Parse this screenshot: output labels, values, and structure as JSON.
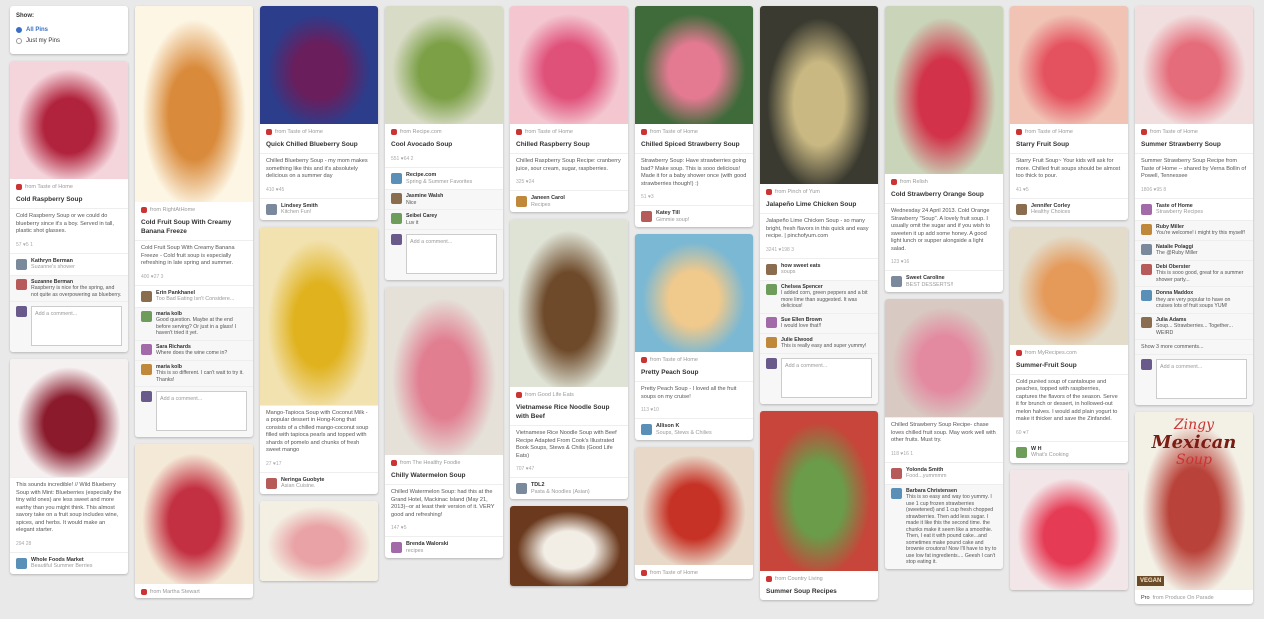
{
  "filter": {
    "title": "Show:",
    "options": [
      "All Pins",
      "Just my Pins"
    ],
    "selected": "All Pins"
  },
  "add_comment_placeholder": "Add a comment...",
  "columns": [
    [
      {
        "img": {
          "h": 118,
          "c1": "#f5d5dc",
          "c2": "#b1233d"
        },
        "src": "from Taste of Home",
        "title": "Cold Raspberry Soup",
        "desc": "Cold Raspberry Soup or we could do blueberry since it's a boy. Served in tall, plastic shot glasses.",
        "stats": "57  ♥5  1",
        "board": {
          "user": "Kathryn Berman",
          "name": "Suzanne's shower"
        },
        "comments": [
          {
            "user": "Suzanne Berman",
            "text": "Raspberry is nice for the spring, and not quite as overpowering as blueberry."
          }
        ],
        "addc": true
      },
      {
        "img": {
          "h": 118,
          "c1": "#f6f1f1",
          "c2": "#8a1a2c"
        },
        "desc": "This sounds incredible! // Wild Blueberry Soup with Mint: Blueberries (especially the tiny wild ones) are less sweet and more earthy than you might think. This almost savory take on a fruit soup includes wine, spices, and herbs. It would make an elegant starter.",
        "stats": "294  28",
        "board": {
          "user": "Whole Foods Market",
          "name": "Beautiful Summer Berries"
        }
      }
    ],
    [
      {
        "img": {
          "h": 196,
          "c1": "#fdf6e4",
          "c2": "#d98a3a"
        },
        "src": "from RightAtHome",
        "title": "Cold Fruit Soup With Creamy Banana Freeze",
        "desc": "Cold Fruit Soup With Creamy Banana Freeze - Cold fruit soup is especially refreshing in late spring and summer.",
        "stats": "400  ♥27  3",
        "board": {
          "user": "Erin Pankhanel",
          "name": "Too Bad Eating Isn't Considere..."
        },
        "comments": [
          {
            "user": "maria kolb",
            "text": "Good question. Maybe at the end before serving? Or just in a glass! I haven't tried it yet."
          },
          {
            "user": "Sara Richards",
            "text": "Where does the wine come in?"
          },
          {
            "user": "maria kolb",
            "text": "This is so different. I can't wait to try it. Thanks!"
          }
        ],
        "addc": true
      },
      {
        "img": {
          "h": 140,
          "c1": "#f4e9d6",
          "c2": "#c33042"
        },
        "src": "from Martha Stewart"
      }
    ],
    [
      {
        "img": {
          "h": 118,
          "c1": "#2c3d8c",
          "c2": "#6a1e5c"
        },
        "src": "from Taste of Home",
        "title": "Quick Chilled Blueberry Soup",
        "desc": "Chilled Blueberry Soup - my mom makes something like this and it's absolutely delicious on a summer day",
        "stats": "410  ♥45",
        "board": {
          "user": "Lindsey Smith",
          "name": "Kitchen Fun!"
        }
      },
      {
        "img": {
          "h": 178,
          "c1": "#f2e2b0",
          "c2": "#e0b21e"
        },
        "desc": "Mango-Tapioca Soup with Coconut Milk - a popular dessert in Hong-Kong that consists of a chilled mango-coconut soup filled with tapioca pearls and topped with shards of pomelo and chunks of fresh sweet mango",
        "stats": "27  ♥17",
        "board": {
          "user": "Neringa Guobyte",
          "name": "Asian Cuisine."
        }
      },
      {
        "img": {
          "h": 80,
          "c1": "#f3efe2",
          "c2": "#e9a3a6"
        }
      }
    ],
    [
      {
        "img": {
          "h": 118,
          "c1": "#d8dbc6",
          "c2": "#7ca046"
        },
        "src": "from Recipe.com",
        "title": "Cool Avocado Soup",
        "desc": "",
        "stats": "551  ♥64  2",
        "board": {
          "user": "Recipe.com",
          "name": "Spring & Summer Favorites"
        },
        "comments": [
          {
            "user": "Jasmine Walsh",
            "text": "Nice"
          },
          {
            "user": "Seibei Carey",
            "text": "Luv it"
          }
        ],
        "addc": true
      },
      {
        "img": {
          "h": 168,
          "c1": "#e5e0d8",
          "c2": "#e17f91"
        },
        "src": "from The Healthy Foodie",
        "title": "Chilly Watermelon Soup",
        "desc": "Chilled Watermelon Soup: had this at the Grand Hotel, Mackinac Island (May 21, 2013)--or at least their version of it. VERY good and refreshing!",
        "stats": "147  ♥5",
        "board": {
          "user": "Brenda Walorski",
          "name": "recipes"
        }
      }
    ],
    [
      {
        "img": {
          "h": 118,
          "c1": "#f3c6d0",
          "c2": "#e0517a"
        },
        "src": "from Taste of Home",
        "title": "Chilled Raspberry Soup",
        "desc": "Chilled Raspberry Soup Recipe: cranberry juice, sour cream, sugar, raspberries.",
        "stats": "325  ♥24",
        "board": {
          "user": "Janeen Carol",
          "name": "Recipes"
        }
      },
      {
        "img": {
          "h": 168,
          "c1": "#dfe3d6",
          "c2": "#6e4a2a"
        },
        "src": "from Good Life Eats",
        "title": "Vietnamese Rice Noodle Soup with Beef",
        "desc": "Vietnamese Rice Noodle Soup with Beef Recipe Adapted From Cook's Illustrated Book Soups, Stews & Chilis (Good Life Eats)",
        "stats": "707  ♥47",
        "board": {
          "user": "TDL2",
          "name": "Pasta & Noodles (Asian)"
        }
      },
      {
        "img": {
          "h": 80,
          "c1": "#6b3a1e",
          "c2": "#f2eee6"
        }
      }
    ],
    [
      {
        "img": {
          "h": 118,
          "c1": "#3f6b3a",
          "c2": "#e47a92"
        },
        "src": "from Taste of Home",
        "title": "Chilled Spiced Strawberry Soup",
        "desc": "Strawberry Soup: Have strawberries going bad? Make soup. This is sooo delicious! Made it for a baby shower once (with good strawberries though!) :)",
        "stats": "51  ♥3",
        "board": {
          "user": "Katey Till",
          "name": "Gimmie soup!"
        }
      },
      {
        "img": {
          "h": 118,
          "c1": "#7ab8d4",
          "c2": "#f0c98c"
        },
        "src": "from Taste of Home",
        "title": "Pretty Peach Soup",
        "desc": "Pretty Peach Soup - I loved all the fruit soups on my cruise!",
        "stats": "113  ♥10",
        "board": {
          "user": "Allison K",
          "name": "Soups, Stews & Chilies"
        }
      },
      {
        "img": {
          "h": 118,
          "c1": "#e8d8c8",
          "c2": "#c63326"
        },
        "src": "from Taste of Home"
      }
    ],
    [
      {
        "img": {
          "h": 178,
          "c1": "#3a3a30",
          "c2": "#c9b882"
        },
        "src": "from Pinch of Yum",
        "title": "Jalapeño Lime Chicken Soup",
        "desc": "Jalapeño Lime Chicken Soup - so many bright, fresh flavors in this quick and easy recipe. | pinchofyum.com",
        "stats": "3241  ♥198  3",
        "board": {
          "user": "how sweet eats",
          "name": "soups"
        },
        "comments": [
          {
            "user": "Chelsea Spencer",
            "text": "I added corn, green peppers and a bit more lime than suggested. It was delicious!"
          },
          {
            "user": "Sue Ellen Brown",
            "text": "I would love that!!"
          },
          {
            "user": "Julie Elwood",
            "text": "This is really easy and super yummy!"
          }
        ],
        "addc": true
      },
      {
        "img": {
          "h": 160,
          "c1": "#c7453a",
          "c2": "#6a9c4a"
        },
        "src": "from Country Living",
        "title": "Summer Soup Recipes"
      }
    ],
    [
      {
        "img": {
          "h": 168,
          "c1": "#c9d4b8",
          "c2": "#d2334a"
        },
        "src": "from Relish",
        "title": "Cold Strawberry Orange Soup",
        "desc": "Wednesday 24 April 2013. Cold Orange Strawberry \"Soup\". A lovely fruit soup. I usually omit the sugar and if you wish to sweeten it up add some honey. A good light lunch or supper alongside a light salad.",
        "stats": "123  ♥16",
        "board": {
          "user": "Sweet Caroline",
          "name": "BEST DESSERTS!!"
        }
      },
      {
        "img": {
          "h": 118,
          "c1": "#d8c9c2",
          "c2": "#e38aa0"
        },
        "desc": "Chilled Strawberry Soup Recipe- chase loves chilled fruit soup. May work well with other fruits. Must try.",
        "stats": "118  ♥16  1",
        "board": {
          "user": "Yolonda Smith",
          "name": "Food...yummmm"
        },
        "comments": [
          {
            "user": "Barbara Christensen",
            "text": "This is so easy and way too yummy. I use 1 cup frozen strawberries (sweetened) and 1 cup fresh chopped strawberries. Then add less sugar. I made it like this the second time. the chunks make it seem like a smoothie. Then, I eat it with pound cake...and sometimes make pound cake and brownie croutons! Now I'll have to try to use low fat ingredients.... Geesh I can't stop eating it."
          }
        ]
      }
    ],
    [
      {
        "img": {
          "h": 118,
          "c1": "#f0c3b5",
          "c2": "#e5525f"
        },
        "src": "from Taste of Home",
        "title": "Starry Fruit Soup",
        "desc": "Starry Fruit Soup~ Your kids will ask for more. Chilled fruit soups should be almost too thick to pour.",
        "stats": "41  ♥5",
        "board": {
          "user": "Jennifer Corley",
          "name": "Healthy Choices"
        }
      },
      {
        "img": {
          "h": 118,
          "c1": "#e3dccb",
          "c2": "#e59a5a"
        },
        "src": "from MyRecipes.com",
        "title": "Summer-Fruit Soup",
        "desc": "Cold puréed soup of cantaloupe and peaches, topped with raspberries, captures the flavors of the season. Serve it for brunch or dessert, in hollowed-out melon halves. I would add plain yogurt to make it thicker and save the Zinfandel.",
        "stats": "60  ♥7",
        "board": {
          "user": "W H",
          "name": "What's Cooking"
        }
      },
      {
        "img": {
          "h": 120,
          "c1": "#f3e6e8",
          "c2": "#e63b55"
        }
      }
    ],
    [
      {
        "img": {
          "h": 118,
          "c1": "#f1dede",
          "c2": "#e56c7a"
        },
        "src": "from Taste of Home",
        "title": "Summer Strawberry Soup",
        "desc": "Summer Strawberry Soup Recipe from Taste of Home -- shared by Verna Bollin of Powell, Tennessee",
        "stats": "1806  ♥95  8",
        "board": {
          "user": "Taste of Home",
          "name": "Strawberry Recipes"
        },
        "comments": [
          {
            "user": "Ruby Miller",
            "text": "You're welcome! i might try this myself!"
          },
          {
            "user": "Natalie Polaggi",
            "text": "The @Ruby Miller"
          },
          {
            "user": "Debi Oberster",
            "text": "This is sooo good, great for a summer shower party..."
          },
          {
            "user": "Donna Maddox",
            "text": "they are very popular to have on cruises lots of fruit soups YUM!"
          },
          {
            "user": "Julia Adams",
            "text": "Soup... Strawberries... Together... WEIRD"
          }
        ],
        "more": "Show 3 more comments...",
        "addc": true
      },
      {
        "img": {
          "h": 178,
          "c1": "#f3f0e6",
          "c2": "#b9433a"
        },
        "overlay": [
          "Zingy",
          "Mexican",
          "Soup"
        ],
        "badge": "VEGAN",
        "src": "from Produce On Parade",
        "srcUser": "Pro"
      }
    ]
  ]
}
